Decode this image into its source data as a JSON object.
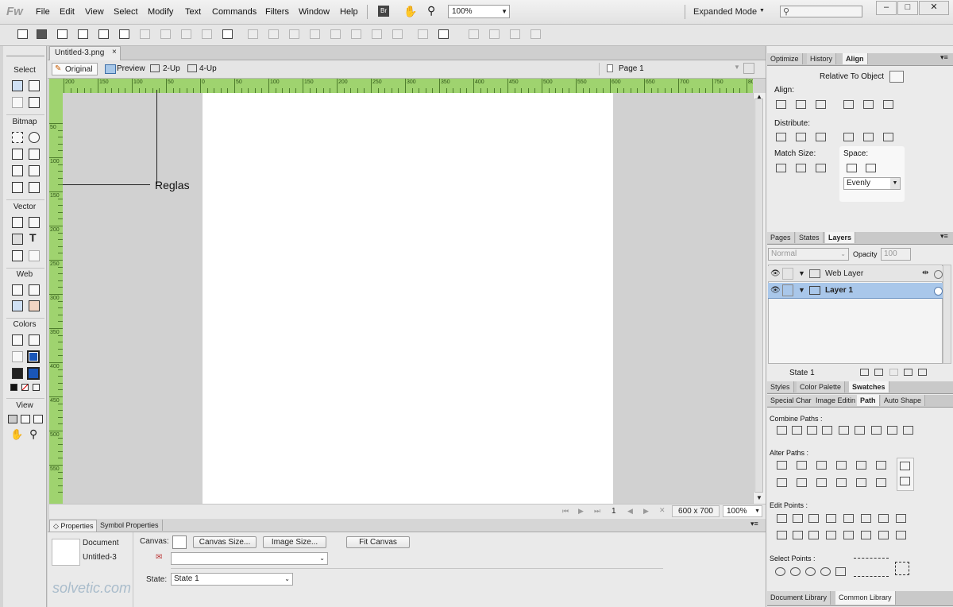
{
  "app": {
    "logo": "Fw",
    "menu": [
      "File",
      "Edit",
      "View",
      "Select",
      "Modify",
      "Text",
      "Commands",
      "Filters",
      "Window",
      "Help"
    ],
    "bridge_label": "Br",
    "zoom_value": "100%",
    "mode": "Expanded Mode",
    "search_placeholder": ""
  },
  "document": {
    "tab_label": "Untitled-3.png",
    "tab_close": "×",
    "views": [
      "Original",
      "Preview",
      "2-Up",
      "4-Up"
    ],
    "page_label": "Page 1",
    "hruler_ticks": [
      "200",
      "150",
      "100",
      "50",
      "0",
      "50",
      "100",
      "150",
      "200",
      "250",
      "300",
      "350",
      "400",
      "450",
      "500",
      "550",
      "600",
      "650",
      "700",
      "750",
      "800"
    ],
    "vruler_ticks": [
      "50",
      "100",
      "150",
      "200",
      "250",
      "300",
      "350",
      "400",
      "450",
      "500",
      "550"
    ],
    "annotation": "Reglas",
    "status": {
      "frame": "1",
      "size": "600 x 700",
      "zoom": "100%"
    }
  },
  "tools": {
    "sections": [
      "Select",
      "Bitmap",
      "Vector",
      "Web",
      "Colors",
      "View"
    ],
    "stroke_color": "#1a56b8",
    "fill_color": "#1a56b8"
  },
  "properties": {
    "tabs": [
      "Properties",
      "Symbol Properties"
    ],
    "doc_type": "Document",
    "doc_name": "Untitled-3",
    "canvas_label": "Canvas:",
    "canvas_size_btn": "Canvas Size...",
    "image_size_btn": "Image Size...",
    "fit_canvas_btn": "Fit Canvas",
    "state_label": "State:",
    "state_value": "State 1"
  },
  "align_panel": {
    "tabs": [
      "Optimize",
      "History",
      "Align"
    ],
    "relative_to": "Relative To Object",
    "align_label": "Align:",
    "distribute_label": "Distribute:",
    "match_size_label": "Match Size:",
    "space_label": "Space:",
    "space_value": "Evenly"
  },
  "layers_panel": {
    "tabs": [
      "Pages",
      "States",
      "Layers"
    ],
    "blend_mode": "Normal",
    "opacity_label": "Opacity",
    "opacity_value": "100",
    "layers": [
      {
        "name": "Web Layer",
        "selected": false
      },
      {
        "name": "Layer 1",
        "selected": true
      }
    ],
    "state_footer": "State 1"
  },
  "swatches_panel": {
    "tabs": [
      "Styles",
      "Color Palette",
      "Swatches"
    ]
  },
  "path_panel": {
    "tabs": [
      "Special Char",
      "Image Editin",
      "Path",
      "Auto Shape"
    ],
    "combine_label": "Combine Paths :",
    "alter_label": "Alter Paths :",
    "edit_label": "Edit Points :",
    "select_label": "Select Points :"
  },
  "library_panel": {
    "tabs": [
      "Document Library",
      "Common Library"
    ]
  },
  "watermark": "solvetic.com"
}
